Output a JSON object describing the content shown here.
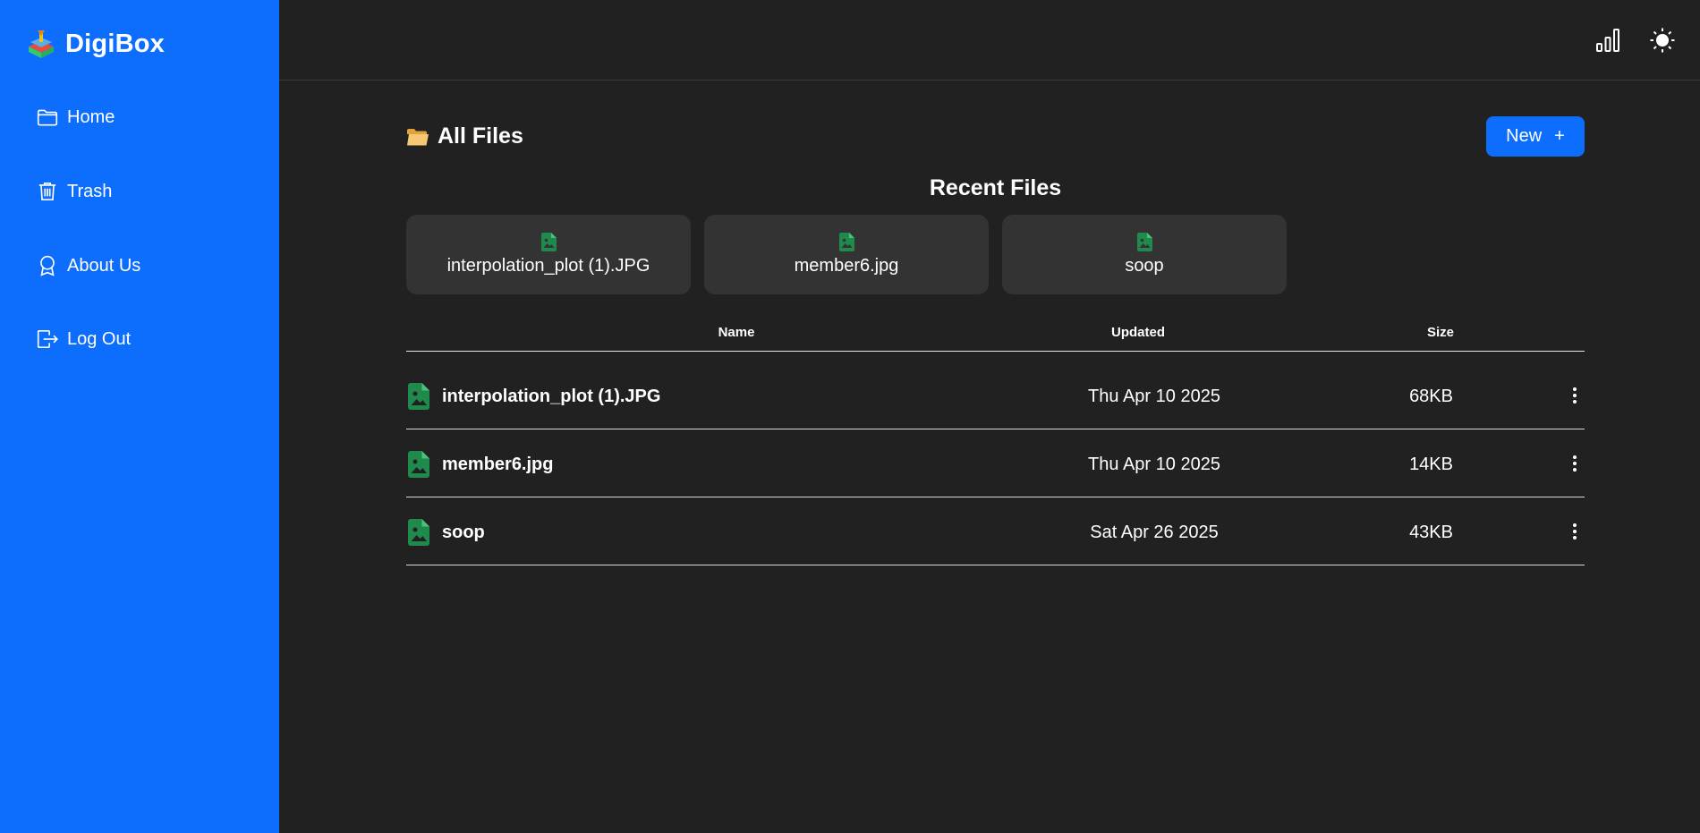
{
  "sidebar": {
    "brand": "DigiBox",
    "items": [
      {
        "label": "Home",
        "icon": "folder-icon"
      },
      {
        "label": "Trash",
        "icon": "trash-icon"
      },
      {
        "label": "About Us",
        "icon": "award-icon"
      },
      {
        "label": "Log Out",
        "icon": "logout-icon"
      }
    ]
  },
  "topbar": {
    "icons": [
      "bar-chart-icon",
      "sun-icon"
    ]
  },
  "main": {
    "title": "All Files",
    "new_button": "New",
    "new_button_icon": "+",
    "recent_title": "Recent Files",
    "recent_files": [
      {
        "name": "interpolation_plot (1).JPG"
      },
      {
        "name": "member6.jpg"
      },
      {
        "name": "soop"
      }
    ],
    "table": {
      "columns": [
        "Name",
        "Updated",
        "Size"
      ],
      "rows": [
        {
          "name": "interpolation_plot (1).JPG",
          "updated": "Thu Apr 10 2025",
          "size": "68KB"
        },
        {
          "name": "member6.jpg",
          "updated": "Thu Apr 10 2025",
          "size": "14KB"
        },
        {
          "name": "soop",
          "updated": "Sat Apr 26 2025",
          "size": "43KB"
        }
      ]
    }
  },
  "colors": {
    "sidebar_bg": "#0d6efd",
    "page_bg": "#212121",
    "card_bg": "#333333",
    "file_icon": "#1e8a4c",
    "accent": "#0d6efd"
  }
}
